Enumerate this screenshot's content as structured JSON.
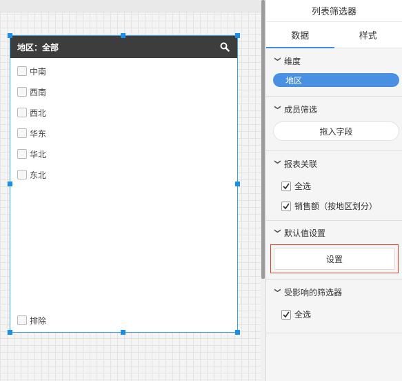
{
  "widget": {
    "title": "地区：全部",
    "items": [
      "中南",
      "西南",
      "西北",
      "华东",
      "华北",
      "东北"
    ],
    "exclude_label": "排除"
  },
  "panel": {
    "title": "列表筛选器",
    "tabs": [
      "数据",
      "样式"
    ],
    "active_tab": "数据",
    "dimension": {
      "label": "维度",
      "field": "地区"
    },
    "member_filter": {
      "label": "成员筛选",
      "dropzone": "拖入字段"
    },
    "report_link": {
      "label": "报表关联",
      "select_all": "全选",
      "item": "销售额（按地区划分）"
    },
    "default_value": {
      "label": "默认值设置",
      "button": "设置"
    },
    "affected": {
      "label": "受影响的筛选器",
      "select_all": "全选"
    }
  },
  "colors": {
    "accent": "#4a90e2",
    "header_bg": "#3d3d3d",
    "highlight": "#d9432b"
  }
}
